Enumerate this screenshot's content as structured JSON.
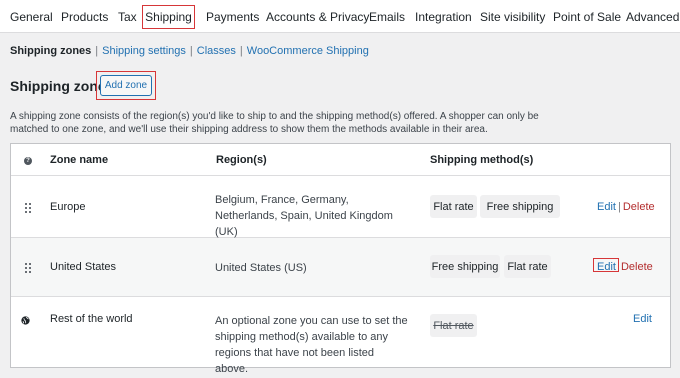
{
  "tabs": [
    "General",
    "Products",
    "Tax",
    "Shipping",
    "Payments",
    "Accounts & Privacy",
    "Emails",
    "Integration",
    "Site visibility",
    "Point of Sale",
    "Advanced"
  ],
  "active_tab": "Shipping",
  "subnav": {
    "current": "Shipping zones",
    "links": [
      "Shipping settings",
      "Classes",
      "WooCommerce Shipping"
    ],
    "separator": "|"
  },
  "page": {
    "title": "Shipping zones",
    "add_zone_label": "Add zone",
    "description": "A shipping zone consists of the region(s) you'd like to ship to and the shipping method(s) offered. A shopper can only be matched to one zone, and we'll use their shipping address to show them the methods available in their area."
  },
  "table": {
    "help_icon_glyph": "?",
    "headers": {
      "zone_name": "Zone name",
      "regions": "Region(s)",
      "methods": "Shipping method(s)"
    },
    "rows": [
      {
        "zone": "Europe",
        "regions": "Belgium, France, Germany, Netherlands, Spain, United Kingdom (UK)",
        "methods": [
          "Flat rate",
          "Free shipping"
        ],
        "edit": "Edit",
        "sep": "|",
        "delete": "Delete",
        "icon": "drag-handle-icon"
      },
      {
        "zone": "United States",
        "regions": "United States (US)",
        "methods": [
          "Free shipping",
          "Flat rate"
        ],
        "edit": "Edit",
        "delete": "Delete",
        "icon": "drag-handle-icon"
      },
      {
        "zone": "Rest of the world",
        "regions": "An optional zone you can use to set the shipping method(s) available to any regions that have not been listed above.",
        "methods": [
          "Flat rate"
        ],
        "method_disabled": true,
        "edit": "Edit",
        "icon": "globe-icon"
      }
    ]
  },
  "colors": {
    "accent": "#2271b1",
    "danger": "#b32d2e",
    "highlight_box": "#d63638"
  }
}
